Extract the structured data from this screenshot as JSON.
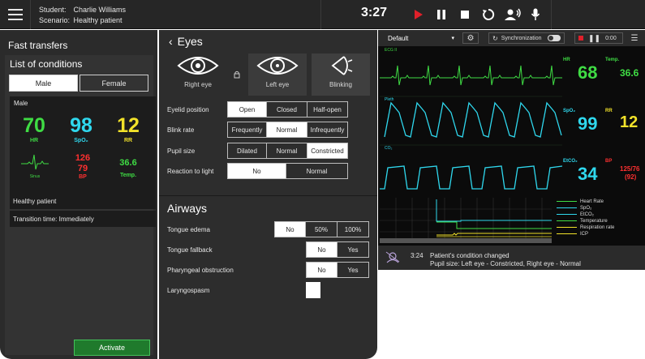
{
  "header": {
    "student_label": "Student:",
    "student_name": "Charlie Williams",
    "scenario_label": "Scenario:",
    "scenario_name": "Healthy patient",
    "timer": "3:27"
  },
  "left": {
    "title": "Fast transfers",
    "subtitle": "List of conditions",
    "male_label": "Male",
    "female_label": "Female",
    "card_label": "Male",
    "hr_value": "70",
    "hr_label": "HR",
    "spo2_value": "98",
    "spo2_label": "SpO₂",
    "rr_value": "12",
    "rr_label": "RR",
    "sinus_label": "Sinus",
    "bp_sys": "126",
    "bp_dia": "79",
    "bp_label": "BP",
    "temp_value": "36.6",
    "temp_label": "Temp.",
    "condition_name": "Healthy patient",
    "transition": "Transition time: Immediately",
    "activate_label": "Activate"
  },
  "eyes": {
    "title": "Eyes",
    "tiles": [
      {
        "label": "Right eye"
      },
      {
        "label": "Left eye"
      },
      {
        "label": "Blinking"
      }
    ],
    "rows": [
      {
        "label": "Eyelid position",
        "options": [
          "Open",
          "Closed",
          "Half-open"
        ],
        "selected": 0
      },
      {
        "label": "Blink rate",
        "options": [
          "Frequently",
          "Normal",
          "Infrequently"
        ],
        "selected": 1
      },
      {
        "label": "Pupil size",
        "options": [
          "Dilated",
          "Normal",
          "Constricted"
        ],
        "selected": 2
      },
      {
        "label": "Reaction to light",
        "options": [
          "No",
          "Normal"
        ],
        "selected": 0
      }
    ]
  },
  "airways": {
    "title": "Airways",
    "rows": [
      {
        "label": "Tongue edema",
        "options": [
          "No",
          "50%",
          "100%"
        ],
        "selected": 0
      },
      {
        "label": "Tongue fallback",
        "options": [
          "No",
          "Yes"
        ],
        "selected": 0
      },
      {
        "label": "Pharyngeal obstruction",
        "options": [
          "No",
          "Yes"
        ],
        "selected": 0
      },
      {
        "label": "Laryngospasm",
        "options": [],
        "selected": 0
      }
    ]
  },
  "monitor": {
    "preset": "Default",
    "sync_label": "Synchronization",
    "rec_time": "0:00",
    "wave_labels": [
      "ECG II",
      "Pleth",
      "CO₂"
    ],
    "hr_label": "HR",
    "hr_value": "68",
    "temp_label": "Temp.",
    "temp_value": "36.6",
    "spo2_label": "SpO₂",
    "spo2_value": "99",
    "rr_label": "RR",
    "rr_value": "12",
    "etco2_label": "EtCO₂",
    "etco2_value": "34",
    "bp_label": "BP",
    "bp_value": "125/76",
    "bp_mean": "(92)",
    "legend": [
      "Heart Rate",
      "SpO₂",
      "EtCO₂",
      "Temperature",
      "Respiration rate",
      "ICP"
    ],
    "event_time": "3:24",
    "event_title": "Patient's condition changed",
    "event_detail": "Pupil size: Left eye - Constricted, Right eye - Normal"
  },
  "colors": {
    "green": "#3fdc44",
    "cyan": "#2fd8ee",
    "yellow": "#f2e22a",
    "red": "#ff3030",
    "accent_red": "#e0202a"
  }
}
